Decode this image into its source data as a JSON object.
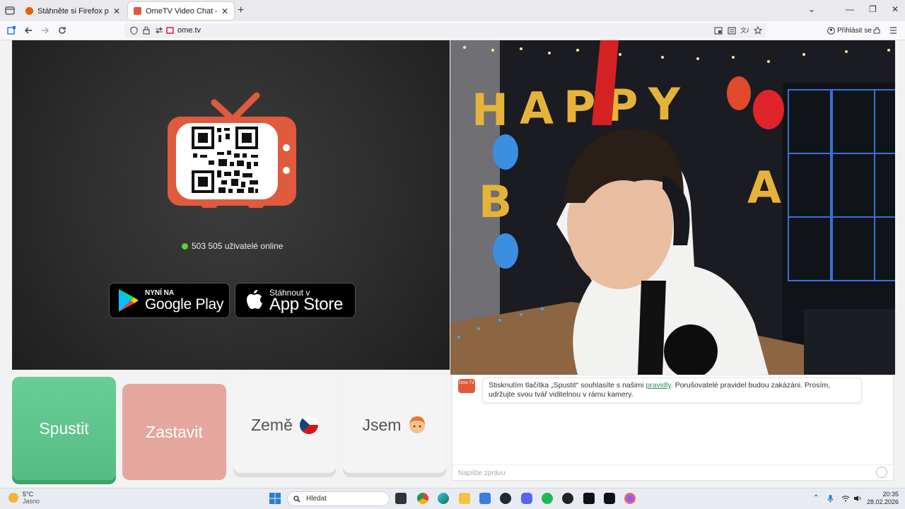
{
  "browser": {
    "tabs": [
      {
        "title": "Stáhněte si Firefox pro Android",
        "close": "✕"
      },
      {
        "title": "OmeTV Video Chat — Ome",
        "close": "✕"
      }
    ],
    "new_tab": "+",
    "url": "ome.tv",
    "signin_label": "Přihlásit se",
    "window_controls": [
      "⌄",
      "—",
      "❐",
      "✕"
    ]
  },
  "left_panel": {
    "online_text": "503 505 uživatelé online",
    "google_play": {
      "small": "NYNÍ NA",
      "big": "Google Play"
    },
    "app_store": {
      "small": "Stáhnout v",
      "big": "App Store"
    }
  },
  "controls": {
    "start_label": "Spustit",
    "stop_label": "Zastavit",
    "country_label": "Země",
    "gender_label": "Jsem"
  },
  "chat": {
    "logo_text": "Ome TV",
    "message_before": "Stisknutím tlačítka „Spustit“ souhlasíte s našimi ",
    "message_link": "pravidly",
    "message_after": ". Porušovatelé pravidel budou zakázáni. Prosím, udržujte svou tvář viditelnou v rámu kamery.",
    "input_placeholder": "Napište zprávu"
  },
  "taskbar": {
    "temp": "5°C",
    "weather": "Jasno",
    "search_placeholder": "Hledat",
    "time": "20:35",
    "date": "28.02.2026"
  },
  "colors": {
    "start_green": "#5ec48c",
    "stop_salmon": "#e5a79d",
    "tv_orange": "#e05a3d",
    "online_dot": "#5ad23a"
  }
}
